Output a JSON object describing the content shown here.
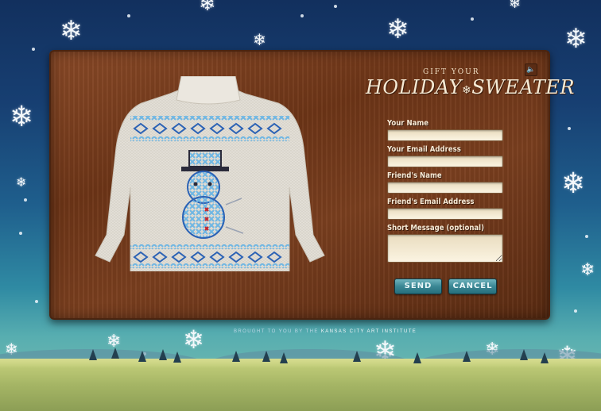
{
  "logo": {
    "top_text": "GIFT YOUR",
    "main_left": "HOLIDAY",
    "main_right": "SWEATER"
  },
  "sound_icon": "speaker-icon",
  "form": {
    "fields": [
      {
        "label": "Your Name",
        "value": ""
      },
      {
        "label": "Your Email Address",
        "value": ""
      },
      {
        "label": "Friend's Name",
        "value": ""
      },
      {
        "label": "Friend's Email Address",
        "value": ""
      },
      {
        "label": "Short Message (optional)",
        "value": ""
      }
    ],
    "send_label": "SEND",
    "cancel_label": "CANCEL"
  },
  "credit": {
    "prefix": "BROUGHT TO YOU BY THE",
    "org": "KANSAS CITY ART INSTITUTE"
  },
  "colors": {
    "board": "#6d3517",
    "button": "#3a8794",
    "cream_text": "#f7ead6",
    "stitch_light": "#6fb7e4",
    "stitch_dark": "#2b62b5",
    "stitch_top": "#2a2a3a",
    "stitch_red": "#c4262e"
  }
}
